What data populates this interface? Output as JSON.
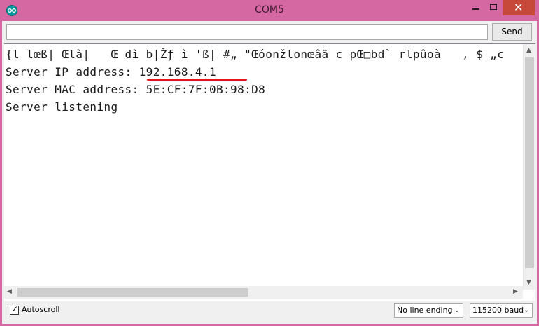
{
  "window": {
    "title": "COM5",
    "close_glyph": "✕"
  },
  "send": {
    "input_value": "",
    "button_label": "Send"
  },
  "output": {
    "lines": [
      "{l lœß| Œlà|   Œ dì b|Žƒ ì 'ß| #„ \"Œóonžlonœâä c pŒ□bd` rlpûoà   , $ „c",
      "Server IP address: 192.168.4.1",
      "Server MAC address: 5E:CF:7F:0B:98:D8",
      "Server listening"
    ],
    "highlight_color": "#e3141b"
  },
  "footer": {
    "autoscroll_label": "Autoscroll",
    "autoscroll_checked": true,
    "checkmark": "✓",
    "line_ending": "No line ending",
    "baud": "115200 baud"
  },
  "icons": {
    "app": "arduino-icon",
    "dropdown": "chevron-down-icon",
    "scroll_up": "▲",
    "scroll_down": "▼",
    "scroll_left": "◀",
    "scroll_right": "▶",
    "chevron": "⌄"
  },
  "colors": {
    "frame": "#d567a3",
    "close_button": "#c7493a",
    "app_icon": "#00979d"
  }
}
